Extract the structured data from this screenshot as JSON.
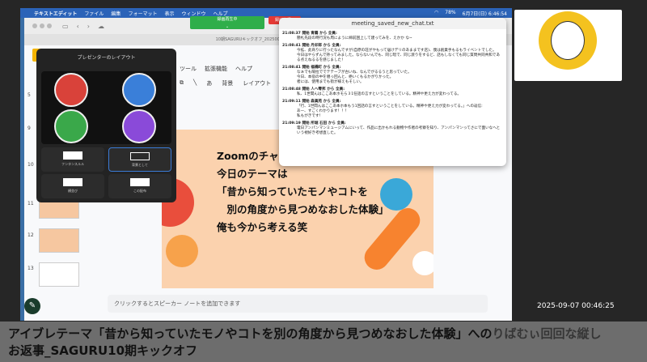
{
  "menubar": {
    "app": "テキストエディット",
    "items": [
      "ファイル",
      "編集",
      "フォーマット",
      "表示",
      "ウィンドウ",
      "ヘルプ"
    ],
    "battery": "78%",
    "datetime": "6月7日(日) 6:46:54"
  },
  "browser": {
    "tab_title": "10期SAGURUキックオフ_20250000 - Google スライド",
    "menu": [
      "ツール",
      "拡張機能",
      "ヘルプ"
    ],
    "toolbar": [
      "背景",
      "レイアウト"
    ]
  },
  "zoom": {
    "recording_label": "録画再生中",
    "rec_button": "録画を挿入"
  },
  "text_window": {
    "title": "meeting_saved_new_chat.txt",
    "messages": [
      {
        "header": "21:08:37 開始 青霧 から 全員:",
        "body": [
          "懸札先段の時行況も周にように締前囲上して建ってみを、えかか な~"
        ]
      },
      {
        "header": "21:08:41 開始 丹卯郎 から 全員:",
        "body": [
          "今拡、此商りに行ったなんですが(自原の荘がやもって居けデリのあままです店)、僕は創業手もるもライベントでした。",
          "今日はやらずんで持ってみました。ならないんでも、同じ暗で、同じ渡りをするど、話もしなくても同じ質問共同共和である点えねるるを感じました！"
        ]
      },
      {
        "header": "21:08:41 開始 福橋町 から 全員:",
        "body": [
          "なぁでも陽拉ででテテーブが古いね、なんでがるるうと思っていた。",
          "今日、本宿の中を覗っ回んと、絶いくもるかがりかった。",
          "者には、使用までも街が様えもそしい。"
        ]
      },
      {
        "header": "21:08:48 開始 人へ零邦 から 全員:",
        "body": [
          "私、1世間んはここあ本ホモら３1任話の言すということをしている。精神や更え力が変わってる。"
        ]
      },
      {
        "header": "21:09:11 開始 森眞苑 から 全員:",
        "body": [
          "「行、1世間んはここあ本ホ本もう1回話の言すということをしている。精神や更え力が変わってる。」への返信:",
          "あー、すごくわかります！！！",
          "私もがきです！"
        ]
      },
      {
        "header": "21:09:19 開始 所堀 石田 から 全員:",
        "body": [
          "電日アンパンマンミュージアムにいって、作品に出かもれる動物や作者の考察を知り、アンパンマンってさにで面いなへという視好き考想直した。"
        ]
      }
    ]
  },
  "layout_dialog": {
    "title": "プレゼンターのレイアウト",
    "options": [
      "フンタンスルル",
      "背景として",
      "横並び",
      "この配布"
    ],
    "selected": 1
  },
  "slides": {
    "numbers": [
      "5",
      "9",
      "10",
      "11",
      "12",
      "13"
    ],
    "selected": "10"
  },
  "slide": {
    "lines": [
      "Zoomのチャット",
      "今日のテーマは",
      "「昔から知っていたモノやコトを",
      "　別の角度から見つめなおした体験」",
      "俺も今から考える笑"
    ]
  },
  "notes_placeholder": "クリックするとスピーカー ノートを追加できます",
  "timestamp": "2025-09-07  00:46:25",
  "caption": {
    "line1": "アイブレテーマ「昔から知っていたモノやコトを別の角度から見つめなおした体験」への",
    "line1_tail": "りばむぃ回回な縦し",
    "line2": "お返事_SAGURU10期キックオフ"
  },
  "colors": {
    "menubar": "#2b63b8",
    "zoom_green": "#2fae4a",
    "record_red": "#e53935",
    "slide_bg": "#fbd2ae"
  }
}
